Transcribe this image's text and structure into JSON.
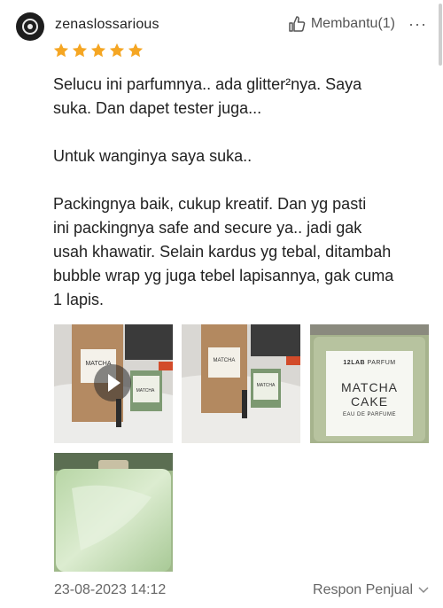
{
  "review": {
    "username": "zenaslossarious",
    "helpful_label": "Membantu(1)",
    "more_label": "···",
    "rating": 5,
    "lines": [
      "Selucu ini parfumnya.. ada glitter²nya. Saya",
      "suka. Dan dapet tester juga...",
      "",
      "Untuk wanginya saya suka..",
      "",
      "Packingnya baik, cukup kreatif. Dan yg pasti",
      "ini packingnya safe and secure ya.. jadi gak",
      "usah khawatir. Selain kardus yg tebal, ditambah",
      "bubble wrap yg juga tebel lapisannya, gak cuma",
      "1 lapis."
    ],
    "date": "23-08-2023 14:12",
    "seller_response_label": "Respon Penjual"
  },
  "media": {
    "box_label": "MATCHA\nCAKE",
    "brand_small": "12LAB",
    "brand_product": "PARFUM",
    "product_name_1": "MATCHA",
    "product_name_2": "CAKE",
    "product_type": "EAU DE PARFUME"
  },
  "colors": {
    "star": "#f5a623",
    "text": "#222222",
    "muted": "#666666"
  }
}
